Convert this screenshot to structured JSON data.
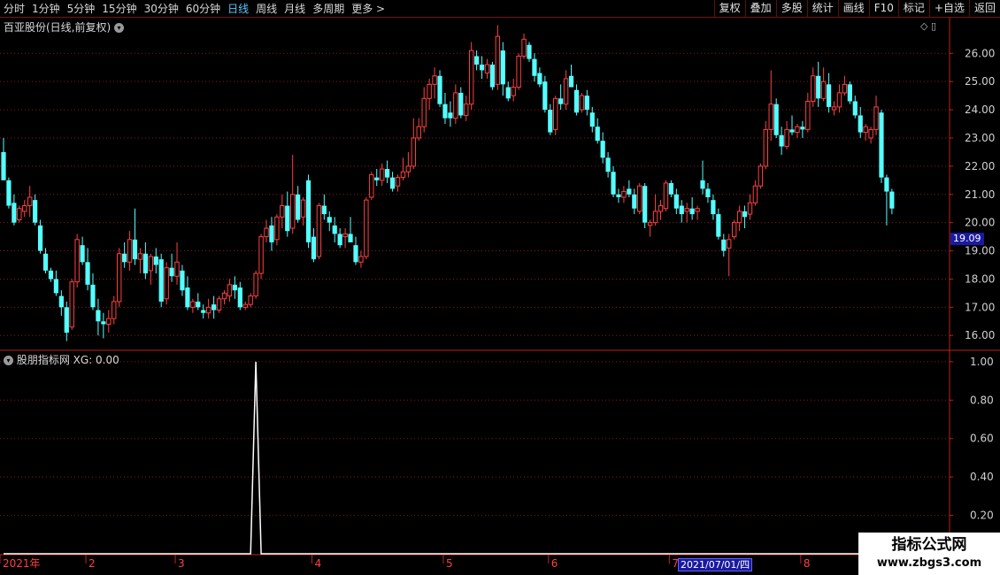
{
  "toolbar": {
    "periods": [
      "分时",
      "1分钟",
      "5分钟",
      "15分钟",
      "30分钟",
      "60分钟",
      "日线",
      "周线",
      "月线",
      "多周期",
      "更多 >"
    ],
    "active_period": "日线",
    "tools": [
      "复权",
      "叠加",
      "多股",
      "统计",
      "画线",
      "F10",
      "标记",
      "+自选",
      "返回"
    ]
  },
  "main": {
    "title": "百亚股份(日线,前复权)",
    "current_price_tag": "19.09",
    "y_ticks": [
      "26.00",
      "25.00",
      "24.00",
      "23.00",
      "22.00",
      "21.00",
      "20.00",
      "19.00",
      "18.00",
      "17.00",
      "16.00"
    ]
  },
  "indicator": {
    "title": "股朋指标网",
    "value_label": "XG: 0.00",
    "y_ticks": [
      "1.00",
      "0.80",
      "0.60",
      "0.40",
      "0.20"
    ]
  },
  "xaxis": {
    "labels": [
      "2021年",
      "2",
      "3",
      "4",
      "5",
      "6",
      "7",
      "8"
    ],
    "cursor_date": "2021/07/01/四"
  },
  "watermark": {
    "line1": "指标公式网",
    "line2": "www.zbgs3.com"
  },
  "colors": {
    "up": "#ff4040",
    "down": "#54ffff",
    "grid": "#8b1a1a",
    "axis": "#c02020",
    "signal": "#ffffff"
  },
  "chart_data": {
    "type": "candlestick",
    "y_range": [
      15.6,
      27.2
    ],
    "indicator_range": [
      0,
      1.05
    ],
    "candles": [
      {
        "o": 22.5,
        "h": 23.0,
        "l": 21.7,
        "c": 21.5
      },
      {
        "o": 21.5,
        "h": 21.6,
        "l": 20.5,
        "c": 20.6
      },
      {
        "o": 20.7,
        "h": 21.0,
        "l": 19.9,
        "c": 20.0
      },
      {
        "o": 20.1,
        "h": 20.6,
        "l": 20.0,
        "c": 20.5
      },
      {
        "o": 20.4,
        "h": 20.8,
        "l": 20.2,
        "c": 20.6
      },
      {
        "o": 20.6,
        "h": 21.3,
        "l": 20.2,
        "c": 20.9
      },
      {
        "o": 20.8,
        "h": 21.0,
        "l": 19.9,
        "c": 20.0
      },
      {
        "o": 19.9,
        "h": 20.1,
        "l": 18.9,
        "c": 19.0
      },
      {
        "o": 18.9,
        "h": 19.1,
        "l": 18.2,
        "c": 18.3
      },
      {
        "o": 18.3,
        "h": 18.4,
        "l": 17.9,
        "c": 18.0
      },
      {
        "o": 18.0,
        "h": 18.3,
        "l": 17.4,
        "c": 17.5
      },
      {
        "o": 17.4,
        "h": 17.6,
        "l": 16.7,
        "c": 17.0
      },
      {
        "o": 17.0,
        "h": 17.2,
        "l": 15.8,
        "c": 16.1
      },
      {
        "o": 16.3,
        "h": 18.0,
        "l": 16.2,
        "c": 17.9
      },
      {
        "o": 17.9,
        "h": 19.6,
        "l": 17.7,
        "c": 19.4
      },
      {
        "o": 19.2,
        "h": 19.5,
        "l": 18.5,
        "c": 18.6
      },
      {
        "o": 18.6,
        "h": 19.1,
        "l": 17.6,
        "c": 17.8
      },
      {
        "o": 17.8,
        "h": 18.2,
        "l": 16.9,
        "c": 17.0
      },
      {
        "o": 16.9,
        "h": 17.3,
        "l": 16.0,
        "c": 16.5
      },
      {
        "o": 16.5,
        "h": 16.8,
        "l": 15.9,
        "c": 16.4
      },
      {
        "o": 16.4,
        "h": 16.9,
        "l": 16.1,
        "c": 16.6
      },
      {
        "o": 16.6,
        "h": 17.4,
        "l": 16.4,
        "c": 17.2
      },
      {
        "o": 17.2,
        "h": 19.1,
        "l": 17.0,
        "c": 18.9
      },
      {
        "o": 18.9,
        "h": 19.3,
        "l": 18.4,
        "c": 18.6
      },
      {
        "o": 18.6,
        "h": 19.7,
        "l": 18.3,
        "c": 19.4
      },
      {
        "o": 19.4,
        "h": 20.5,
        "l": 18.5,
        "c": 18.7
      },
      {
        "o": 18.7,
        "h": 19.1,
        "l": 18.2,
        "c": 18.9
      },
      {
        "o": 18.9,
        "h": 19.3,
        "l": 18.0,
        "c": 18.2
      },
      {
        "o": 18.3,
        "h": 18.9,
        "l": 17.8,
        "c": 18.8
      },
      {
        "o": 18.8,
        "h": 19.1,
        "l": 18.2,
        "c": 18.5
      },
      {
        "o": 18.7,
        "h": 18.9,
        "l": 17.0,
        "c": 17.2
      },
      {
        "o": 17.3,
        "h": 18.6,
        "l": 17.1,
        "c": 18.4
      },
      {
        "o": 18.4,
        "h": 18.9,
        "l": 17.9,
        "c": 18.1
      },
      {
        "o": 18.1,
        "h": 19.3,
        "l": 17.8,
        "c": 18.6
      },
      {
        "o": 18.3,
        "h": 18.5,
        "l": 17.4,
        "c": 17.6
      },
      {
        "o": 17.7,
        "h": 18.1,
        "l": 16.9,
        "c": 17.0
      },
      {
        "o": 17.0,
        "h": 17.3,
        "l": 16.8,
        "c": 17.2
      },
      {
        "o": 17.2,
        "h": 17.5,
        "l": 16.9,
        "c": 17.0
      },
      {
        "o": 16.9,
        "h": 17.1,
        "l": 16.6,
        "c": 16.8
      },
      {
        "o": 16.8,
        "h": 17.3,
        "l": 16.6,
        "c": 17.0
      },
      {
        "o": 17.1,
        "h": 17.4,
        "l": 16.6,
        "c": 16.9
      },
      {
        "o": 16.9,
        "h": 17.4,
        "l": 16.8,
        "c": 17.3
      },
      {
        "o": 17.3,
        "h": 17.6,
        "l": 17.1,
        "c": 17.5
      },
      {
        "o": 17.4,
        "h": 18.0,
        "l": 17.2,
        "c": 17.8
      },
      {
        "o": 17.8,
        "h": 18.1,
        "l": 17.3,
        "c": 17.6
      },
      {
        "o": 17.7,
        "h": 17.9,
        "l": 16.9,
        "c": 17.0
      },
      {
        "o": 17.0,
        "h": 17.2,
        "l": 16.9,
        "c": 17.1
      },
      {
        "o": 17.1,
        "h": 17.5,
        "l": 17.0,
        "c": 17.4
      },
      {
        "o": 17.4,
        "h": 18.3,
        "l": 17.3,
        "c": 18.2
      },
      {
        "o": 18.2,
        "h": 19.6,
        "l": 18.0,
        "c": 19.5
      },
      {
        "o": 19.5,
        "h": 20.1,
        "l": 19.3,
        "c": 19.8
      },
      {
        "o": 19.9,
        "h": 20.2,
        "l": 19.0,
        "c": 19.3
      },
      {
        "o": 19.4,
        "h": 20.3,
        "l": 19.2,
        "c": 20.2
      },
      {
        "o": 20.2,
        "h": 21.0,
        "l": 19.8,
        "c": 20.6
      },
      {
        "o": 20.6,
        "h": 21.1,
        "l": 19.5,
        "c": 19.7
      },
      {
        "o": 19.8,
        "h": 22.4,
        "l": 19.6,
        "c": 21.0
      },
      {
        "o": 21.0,
        "h": 21.3,
        "l": 20.0,
        "c": 20.1
      },
      {
        "o": 20.2,
        "h": 20.9,
        "l": 19.9,
        "c": 20.8
      },
      {
        "o": 21.5,
        "h": 21.7,
        "l": 19.1,
        "c": 19.3
      },
      {
        "o": 19.5,
        "h": 19.8,
        "l": 18.6,
        "c": 18.7
      },
      {
        "o": 18.8,
        "h": 20.7,
        "l": 18.7,
        "c": 20.6
      },
      {
        "o": 20.6,
        "h": 21.0,
        "l": 20.1,
        "c": 20.3
      },
      {
        "o": 20.2,
        "h": 20.4,
        "l": 19.7,
        "c": 20.0
      },
      {
        "o": 19.9,
        "h": 20.2,
        "l": 19.3,
        "c": 19.6
      },
      {
        "o": 19.6,
        "h": 19.8,
        "l": 19.1,
        "c": 19.2
      },
      {
        "o": 19.5,
        "h": 19.8,
        "l": 19.1,
        "c": 19.6
      },
      {
        "o": 19.6,
        "h": 20.2,
        "l": 19.3,
        "c": 19.3
      },
      {
        "o": 19.2,
        "h": 19.5,
        "l": 18.5,
        "c": 18.6
      },
      {
        "o": 18.6,
        "h": 19.0,
        "l": 18.4,
        "c": 18.8
      },
      {
        "o": 18.8,
        "h": 20.9,
        "l": 18.7,
        "c": 20.8
      },
      {
        "o": 20.9,
        "h": 21.8,
        "l": 20.8,
        "c": 21.7
      },
      {
        "o": 21.6,
        "h": 21.9,
        "l": 21.3,
        "c": 21.5
      },
      {
        "o": 21.5,
        "h": 22.1,
        "l": 21.3,
        "c": 21.9
      },
      {
        "o": 21.9,
        "h": 22.2,
        "l": 21.4,
        "c": 21.6
      },
      {
        "o": 21.6,
        "h": 21.8,
        "l": 21.1,
        "c": 21.2
      },
      {
        "o": 21.3,
        "h": 21.7,
        "l": 21.1,
        "c": 21.6
      },
      {
        "o": 21.6,
        "h": 22.3,
        "l": 21.5,
        "c": 21.8
      },
      {
        "o": 21.8,
        "h": 22.5,
        "l": 21.6,
        "c": 22.0
      },
      {
        "o": 22.0,
        "h": 23.7,
        "l": 21.9,
        "c": 23.0
      },
      {
        "o": 23.0,
        "h": 23.7,
        "l": 22.9,
        "c": 23.4
      },
      {
        "o": 23.4,
        "h": 24.8,
        "l": 23.2,
        "c": 24.4
      },
      {
        "o": 24.4,
        "h": 25.1,
        "l": 24.0,
        "c": 24.9
      },
      {
        "o": 24.9,
        "h": 25.5,
        "l": 24.4,
        "c": 25.2
      },
      {
        "o": 25.2,
        "h": 25.4,
        "l": 24.1,
        "c": 24.2
      },
      {
        "o": 24.2,
        "h": 24.6,
        "l": 23.5,
        "c": 23.7
      },
      {
        "o": 23.9,
        "h": 24.3,
        "l": 23.4,
        "c": 23.7
      },
      {
        "o": 23.7,
        "h": 24.9,
        "l": 23.5,
        "c": 24.6
      },
      {
        "o": 24.6,
        "h": 24.8,
        "l": 23.7,
        "c": 23.8
      },
      {
        "o": 23.8,
        "h": 24.5,
        "l": 23.6,
        "c": 24.2
      },
      {
        "o": 24.2,
        "h": 26.4,
        "l": 24.0,
        "c": 26.1
      },
      {
        "o": 25.9,
        "h": 26.1,
        "l": 25.4,
        "c": 25.6
      },
      {
        "o": 25.6,
        "h": 25.9,
        "l": 25.1,
        "c": 25.4
      },
      {
        "o": 25.3,
        "h": 25.8,
        "l": 25.1,
        "c": 25.6
      },
      {
        "o": 25.6,
        "h": 25.7,
        "l": 24.7,
        "c": 24.8
      },
      {
        "o": 24.9,
        "h": 27.0,
        "l": 24.7,
        "c": 26.6
      },
      {
        "o": 26.1,
        "h": 26.4,
        "l": 24.5,
        "c": 24.9
      },
      {
        "o": 24.8,
        "h": 25.0,
        "l": 24.3,
        "c": 24.4
      },
      {
        "o": 24.5,
        "h": 25.1,
        "l": 24.3,
        "c": 24.8
      },
      {
        "o": 24.8,
        "h": 26.0,
        "l": 24.7,
        "c": 25.9
      },
      {
        "o": 25.9,
        "h": 26.7,
        "l": 25.8,
        "c": 26.5
      },
      {
        "o": 26.3,
        "h": 26.4,
        "l": 25.7,
        "c": 25.8
      },
      {
        "o": 25.8,
        "h": 26.0,
        "l": 25.0,
        "c": 25.2
      },
      {
        "o": 25.3,
        "h": 25.5,
        "l": 24.8,
        "c": 24.9
      },
      {
        "o": 25.0,
        "h": 25.2,
        "l": 23.9,
        "c": 24.0
      },
      {
        "o": 24.0,
        "h": 24.2,
        "l": 23.1,
        "c": 23.2
      },
      {
        "o": 23.3,
        "h": 24.5,
        "l": 23.1,
        "c": 24.4
      },
      {
        "o": 24.4,
        "h": 24.9,
        "l": 24.0,
        "c": 24.2
      },
      {
        "o": 24.2,
        "h": 25.4,
        "l": 24.0,
        "c": 25.1
      },
      {
        "o": 25.2,
        "h": 25.6,
        "l": 24.8,
        "c": 24.8
      },
      {
        "o": 24.7,
        "h": 24.9,
        "l": 23.8,
        "c": 23.9
      },
      {
        "o": 24.0,
        "h": 24.6,
        "l": 23.9,
        "c": 24.5
      },
      {
        "o": 24.5,
        "h": 24.7,
        "l": 23.8,
        "c": 24.0
      },
      {
        "o": 23.9,
        "h": 24.1,
        "l": 23.2,
        "c": 23.4
      },
      {
        "o": 23.4,
        "h": 23.7,
        "l": 22.8,
        "c": 22.9
      },
      {
        "o": 22.9,
        "h": 23.2,
        "l": 22.1,
        "c": 22.3
      },
      {
        "o": 22.3,
        "h": 22.5,
        "l": 21.6,
        "c": 21.8
      },
      {
        "o": 21.8,
        "h": 22.0,
        "l": 20.9,
        "c": 21.0
      },
      {
        "o": 21.0,
        "h": 21.2,
        "l": 20.7,
        "c": 20.9
      },
      {
        "o": 20.9,
        "h": 21.3,
        "l": 20.7,
        "c": 21.1
      },
      {
        "o": 21.2,
        "h": 21.5,
        "l": 20.9,
        "c": 21.0
      },
      {
        "o": 21.0,
        "h": 21.2,
        "l": 20.3,
        "c": 20.5
      },
      {
        "o": 20.4,
        "h": 21.4,
        "l": 20.3,
        "c": 21.3
      },
      {
        "o": 21.3,
        "h": 21.4,
        "l": 19.8,
        "c": 20.0
      },
      {
        "o": 19.9,
        "h": 20.1,
        "l": 19.5,
        "c": 20.0
      },
      {
        "o": 20.0,
        "h": 21.0,
        "l": 19.9,
        "c": 20.4
      },
      {
        "o": 20.4,
        "h": 20.8,
        "l": 20.1,
        "c": 20.6
      },
      {
        "o": 20.5,
        "h": 21.5,
        "l": 20.4,
        "c": 21.4
      },
      {
        "o": 21.4,
        "h": 21.5,
        "l": 20.9,
        "c": 21.0
      },
      {
        "o": 21.0,
        "h": 21.2,
        "l": 20.3,
        "c": 20.5
      },
      {
        "o": 20.6,
        "h": 20.8,
        "l": 20.0,
        "c": 20.3
      },
      {
        "o": 20.4,
        "h": 20.7,
        "l": 20.0,
        "c": 20.5
      },
      {
        "o": 20.5,
        "h": 20.9,
        "l": 20.1,
        "c": 20.3
      },
      {
        "o": 20.4,
        "h": 20.6,
        "l": 20.1,
        "c": 20.5
      },
      {
        "o": 21.5,
        "h": 22.2,
        "l": 21.0,
        "c": 21.2
      },
      {
        "o": 21.2,
        "h": 21.4,
        "l": 20.7,
        "c": 20.9
      },
      {
        "o": 20.8,
        "h": 21.0,
        "l": 20.1,
        "c": 20.3
      },
      {
        "o": 20.3,
        "h": 20.5,
        "l": 19.4,
        "c": 19.5
      },
      {
        "o": 19.4,
        "h": 19.6,
        "l": 18.8,
        "c": 19.0
      },
      {
        "o": 19.1,
        "h": 19.6,
        "l": 18.1,
        "c": 19.4
      },
      {
        "o": 19.5,
        "h": 20.1,
        "l": 19.4,
        "c": 20.0
      },
      {
        "o": 20.0,
        "h": 20.6,
        "l": 19.7,
        "c": 20.4
      },
      {
        "o": 20.4,
        "h": 20.6,
        "l": 19.8,
        "c": 20.2
      },
      {
        "o": 20.3,
        "h": 21.0,
        "l": 20.1,
        "c": 20.7
      },
      {
        "o": 20.7,
        "h": 21.5,
        "l": 20.6,
        "c": 21.3
      },
      {
        "o": 21.3,
        "h": 22.1,
        "l": 21.2,
        "c": 22.0
      },
      {
        "o": 22.0,
        "h": 23.6,
        "l": 21.9,
        "c": 23.3
      },
      {
        "o": 23.3,
        "h": 25.4,
        "l": 22.9,
        "c": 24.2
      },
      {
        "o": 24.2,
        "h": 24.4,
        "l": 23.0,
        "c": 23.1
      },
      {
        "o": 23.1,
        "h": 23.4,
        "l": 22.4,
        "c": 22.7
      },
      {
        "o": 22.7,
        "h": 23.6,
        "l": 22.6,
        "c": 23.3
      },
      {
        "o": 23.3,
        "h": 23.8,
        "l": 23.1,
        "c": 23.2
      },
      {
        "o": 23.2,
        "h": 23.5,
        "l": 23.0,
        "c": 23.4
      },
      {
        "o": 23.4,
        "h": 23.6,
        "l": 23.0,
        "c": 23.3
      },
      {
        "o": 23.3,
        "h": 24.6,
        "l": 23.2,
        "c": 24.3
      },
      {
        "o": 24.3,
        "h": 25.5,
        "l": 24.1,
        "c": 25.2
      },
      {
        "o": 25.2,
        "h": 25.7,
        "l": 24.1,
        "c": 24.4
      },
      {
        "o": 24.4,
        "h": 25.5,
        "l": 24.3,
        "c": 25.0
      },
      {
        "o": 24.9,
        "h": 25.3,
        "l": 23.9,
        "c": 24.1
      },
      {
        "o": 24.0,
        "h": 24.3,
        "l": 23.8,
        "c": 24.1
      },
      {
        "o": 24.1,
        "h": 24.9,
        "l": 23.9,
        "c": 24.6
      },
      {
        "o": 24.6,
        "h": 25.2,
        "l": 24.5,
        "c": 24.9
      },
      {
        "o": 24.9,
        "h": 25.0,
        "l": 24.2,
        "c": 24.3
      },
      {
        "o": 24.3,
        "h": 24.5,
        "l": 23.7,
        "c": 23.8
      },
      {
        "o": 23.8,
        "h": 24.1,
        "l": 23.0,
        "c": 23.2
      },
      {
        "o": 23.2,
        "h": 23.5,
        "l": 22.9,
        "c": 23.4
      },
      {
        "o": 23.0,
        "h": 23.4,
        "l": 22.8,
        "c": 23.3
      },
      {
        "o": 23.3,
        "h": 24.5,
        "l": 23.1,
        "c": 24.1
      },
      {
        "o": 23.9,
        "h": 24.0,
        "l": 21.4,
        "c": 21.6
      },
      {
        "o": 21.6,
        "h": 21.7,
        "l": 19.9,
        "c": 21.1
      },
      {
        "o": 21.1,
        "h": 21.2,
        "l": 20.3,
        "c": 20.5
      }
    ],
    "signal": {
      "index": 48,
      "value": 1.0
    }
  }
}
